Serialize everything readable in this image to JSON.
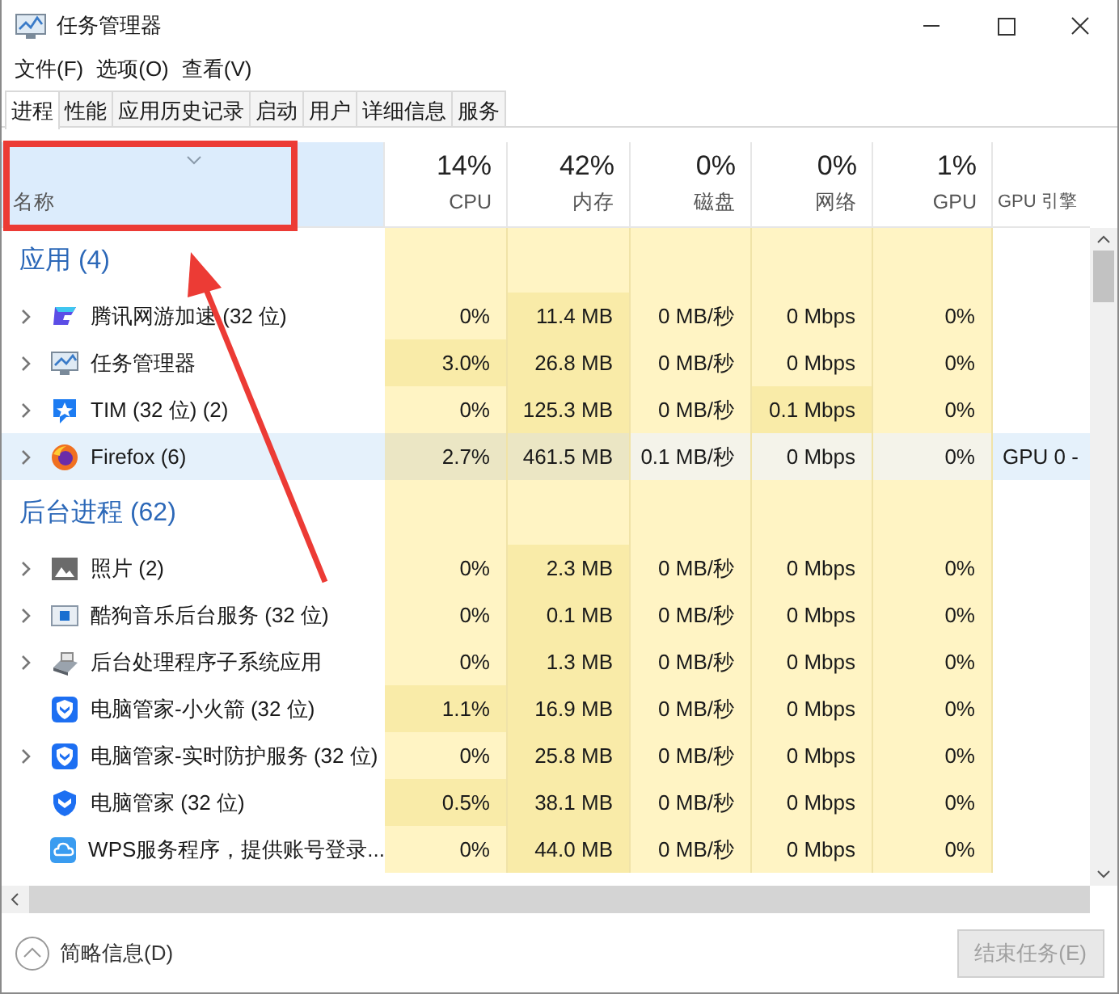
{
  "window": {
    "title": "任务管理器"
  },
  "menu": [
    "文件(F)",
    "选项(O)",
    "查看(V)"
  ],
  "tabs": [
    {
      "label": "进程",
      "selected": true
    },
    {
      "label": "性能",
      "selected": false
    },
    {
      "label": "应用历史记录",
      "selected": false
    },
    {
      "label": "启动",
      "selected": false
    },
    {
      "label": "用户",
      "selected": false
    },
    {
      "label": "详细信息",
      "selected": false
    },
    {
      "label": "服务",
      "selected": false
    }
  ],
  "columns": [
    {
      "label": "名称",
      "sorted": true
    },
    {
      "usage": "14%",
      "label": "CPU",
      "sorted": false
    },
    {
      "usage": "42%",
      "label": "内存",
      "sorted": false
    },
    {
      "usage": "0%",
      "label": "磁盘",
      "sorted": false
    },
    {
      "usage": "0%",
      "label": "网络",
      "sorted": false
    },
    {
      "usage": "1%",
      "label": "GPU",
      "sorted": false
    },
    {
      "label": "GPU 引擎",
      "sorted": false
    }
  ],
  "groups": [
    {
      "title": "应用 (4)",
      "rows": [
        {
          "name": "腾讯网游加速 (32 位)",
          "expandable": true,
          "selected": false,
          "cells": [
            {
              "text": "0%",
              "hot": false
            },
            {
              "text": "11.4 MB",
              "hot": true
            },
            {
              "text": "0 MB/秒",
              "hot": false
            },
            {
              "text": "0 Mbps",
              "hot": false
            },
            {
              "text": "0%",
              "hot": false
            }
          ]
        },
        {
          "name": "任务管理器",
          "expandable": true,
          "selected": false,
          "cells": [
            {
              "text": "3.0%",
              "hot": true
            },
            {
              "text": "26.8 MB",
              "hot": true
            },
            {
              "text": "0 MB/秒",
              "hot": false
            },
            {
              "text": "0 Mbps",
              "hot": false
            },
            {
              "text": "0%",
              "hot": false
            }
          ]
        },
        {
          "name": "TIM (32 位) (2)",
          "expandable": true,
          "selected": false,
          "cells": [
            {
              "text": "0%",
              "hot": false
            },
            {
              "text": "125.3 MB",
              "hot": true
            },
            {
              "text": "0 MB/秒",
              "hot": false
            },
            {
              "text": "0.1 Mbps",
              "hot": true
            },
            {
              "text": "0%",
              "hot": false
            }
          ]
        },
        {
          "name": "Firefox (6)",
          "expandable": true,
          "selected": true,
          "cells": [
            {
              "text": "2.7%",
              "hot": true
            },
            {
              "text": "461.5 MB",
              "hot": true
            },
            {
              "text": "0.1 MB/秒",
              "hot": false
            },
            {
              "text": "0 Mbps",
              "hot": false
            },
            {
              "text": "0%",
              "hot": false
            }
          ],
          "gpu_engine": "GPU 0 -"
        }
      ]
    },
    {
      "title": "后台进程 (62)",
      "rows": [
        {
          "name": "照片 (2)",
          "expandable": true,
          "selected": false,
          "cells": [
            {
              "text": "0%",
              "hot": false
            },
            {
              "text": "2.3 MB",
              "hot": true
            },
            {
              "text": "0 MB/秒",
              "hot": false
            },
            {
              "text": "0 Mbps",
              "hot": false
            },
            {
              "text": "0%",
              "hot": false
            }
          ]
        },
        {
          "name": "酷狗音乐后台服务 (32 位)",
          "expandable": true,
          "selected": false,
          "cells": [
            {
              "text": "0%",
              "hot": false
            },
            {
              "text": "0.1 MB",
              "hot": true
            },
            {
              "text": "0 MB/秒",
              "hot": false
            },
            {
              "text": "0 Mbps",
              "hot": false
            },
            {
              "text": "0%",
              "hot": false
            }
          ]
        },
        {
          "name": "后台处理程序子系统应用",
          "expandable": true,
          "selected": false,
          "cells": [
            {
              "text": "0%",
              "hot": false
            },
            {
              "text": "1.3 MB",
              "hot": true
            },
            {
              "text": "0 MB/秒",
              "hot": false
            },
            {
              "text": "0 Mbps",
              "hot": false
            },
            {
              "text": "0%",
              "hot": false
            }
          ]
        },
        {
          "name": "电脑管家-小火箭 (32 位)",
          "expandable": false,
          "selected": false,
          "cells": [
            {
              "text": "1.1%",
              "hot": true
            },
            {
              "text": "16.9 MB",
              "hot": true
            },
            {
              "text": "0 MB/秒",
              "hot": false
            },
            {
              "text": "0 Mbps",
              "hot": false
            },
            {
              "text": "0%",
              "hot": false
            }
          ]
        },
        {
          "name": "电脑管家-实时防护服务 (32 位)",
          "expandable": true,
          "selected": false,
          "cells": [
            {
              "text": "0%",
              "hot": false
            },
            {
              "text": "25.8 MB",
              "hot": true
            },
            {
              "text": "0 MB/秒",
              "hot": false
            },
            {
              "text": "0 Mbps",
              "hot": false
            },
            {
              "text": "0%",
              "hot": false
            }
          ]
        },
        {
          "name": "电脑管家 (32 位)",
          "expandable": false,
          "selected": false,
          "cells": [
            {
              "text": "0.5%",
              "hot": true
            },
            {
              "text": "38.1 MB",
              "hot": true
            },
            {
              "text": "0 MB/秒",
              "hot": false
            },
            {
              "text": "0 Mbps",
              "hot": false
            },
            {
              "text": "0%",
              "hot": false
            }
          ]
        },
        {
          "name": "WPS服务程序，提供账号登录...",
          "expandable": false,
          "selected": false,
          "cells": [
            {
              "text": "0%",
              "hot": false
            },
            {
              "text": "44.0 MB",
              "hot": true
            },
            {
              "text": "0 MB/秒",
              "hot": false
            },
            {
              "text": "0 Mbps",
              "hot": false
            },
            {
              "text": "0%",
              "hot": false
            }
          ]
        }
      ]
    }
  ],
  "footer": {
    "details": "简略信息(D)",
    "end_task": {
      "label": "结束任务(E)",
      "disabled": true
    }
  }
}
